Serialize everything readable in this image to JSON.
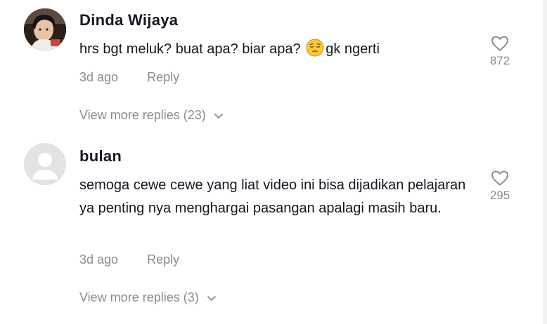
{
  "comments": [
    {
      "username": "Dinda Wijaya",
      "text_before": "hrs bgt meluk? buat apa? biar apa? ",
      "emoji": "pensive-face-icon",
      "text_after": "gk ngerti",
      "time": "3d ago",
      "reply_label": "Reply",
      "likes": "872",
      "view_more": "View more replies (23)"
    },
    {
      "username": "bulan",
      "text": "semoga cewe cewe yang liat video ini bisa dijadikan pelajaran ya penting nya menghargai pasangan apalagi masih baru.",
      "time": "3d ago",
      "reply_label": "Reply",
      "likes": "295",
      "view_more": "View more replies (3)"
    }
  ]
}
